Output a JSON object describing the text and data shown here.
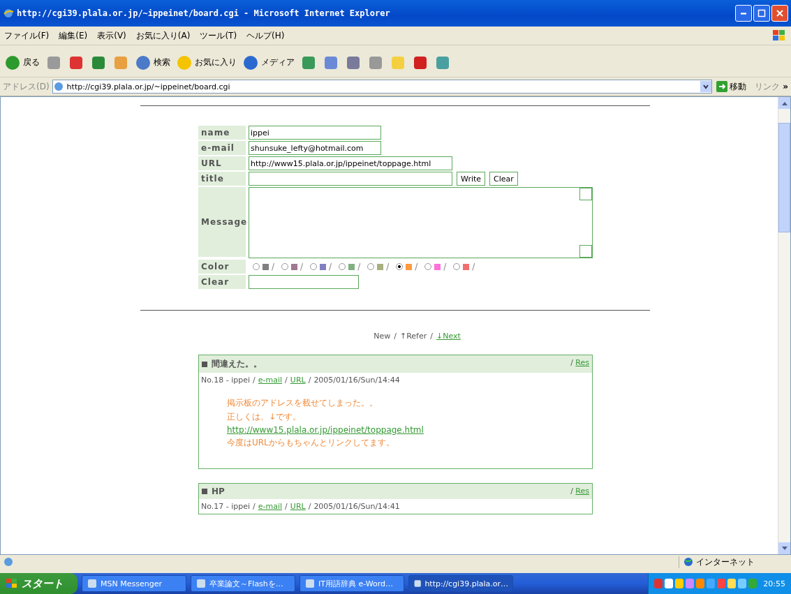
{
  "window": {
    "title": "http://cgi39.plala.or.jp/~ippeinet/board.cgi - Microsoft Internet Explorer"
  },
  "menu": [
    "ファイル(F)",
    "編集(E)",
    "表示(V)",
    "お気に入り(A)",
    "ツール(T)",
    "ヘルプ(H)"
  ],
  "toolbar": [
    {
      "kind": "back",
      "label": "戻る"
    },
    {
      "kind": "forward"
    },
    {
      "kind": "stop"
    },
    {
      "kind": "refresh"
    },
    {
      "kind": "home"
    },
    {
      "kind": "search",
      "label": "検索"
    },
    {
      "kind": "favorites",
      "label": "お気に入り"
    },
    {
      "kind": "media",
      "label": "メディア"
    },
    {
      "kind": "history"
    },
    {
      "kind": "mail"
    },
    {
      "kind": "print"
    },
    {
      "kind": "edit"
    },
    {
      "kind": "note"
    },
    {
      "kind": "messenger"
    },
    {
      "kind": "people"
    }
  ],
  "address": {
    "label": "アドレス(D)",
    "value": "http://cgi39.plala.or.jp/~ippeinet/board.cgi",
    "go": "移動",
    "links": "リンク",
    "more": "»"
  },
  "form": {
    "fields": [
      {
        "label": "name",
        "value": "ippei"
      },
      {
        "label": "e-mail",
        "value": "shunsuke_lefty@hotmail.com"
      },
      {
        "label": "URL",
        "value": "http://www15.plala.or.jp/ippeinet/toppage.html"
      },
      {
        "label": "title"
      }
    ],
    "buttons": [
      "Write",
      "Clear"
    ],
    "message_label": "Message",
    "color_label": "Color",
    "colors": [
      {
        "color": "#808080",
        "selected": false
      },
      {
        "color": "#a07890",
        "selected": false
      },
      {
        "color": "#8080c0",
        "selected": false
      },
      {
        "color": "#80b080",
        "selected": false
      },
      {
        "color": "#a8b080",
        "selected": false
      },
      {
        "color": "#ff9a40",
        "selected": true
      },
      {
        "color": "#ff70d8",
        "selected": false
      },
      {
        "color": "#f07070",
        "selected": false
      }
    ],
    "separator": "/",
    "clear_label": "Clear"
  },
  "nav": {
    "new": "New",
    "sep": "/",
    "refer": "↑Refer",
    "next": "↓Next"
  },
  "posts": [
    {
      "title": "間違えた。。",
      "sep": "/",
      "res": "Res",
      "no": "No.18 - ippei",
      "email": "e-mail",
      "url": "URL",
      "date": "2005/01/16/Sun/14:44",
      "body": [
        {
          "kind": "text",
          "text": "掲示板のアドレスを載せてしまった。。"
        },
        {
          "kind": "text",
          "text": "正しくは、↓です。"
        },
        {
          "kind": "link",
          "text": "http://www15.plala.or.jp/ippeinet/toppage.html"
        },
        {
          "kind": "text",
          "text": "今度はURLからもちゃんとリンクしてます。"
        }
      ]
    },
    {
      "title": "HP",
      "sep": "/",
      "res": "Res",
      "no": "No.17 - ippei",
      "email": "e-mail",
      "url": "URL",
      "date": "2005/01/16/Sun/14:41"
    }
  ],
  "status_bar": {
    "zone": "インターネット"
  },
  "taskbar": {
    "start": "スタート",
    "tasks": [
      {
        "label": "MSN Messenger",
        "selected": false
      },
      {
        "label": "卒業論文～Flashを…",
        "selected": false
      },
      {
        "label": "IT用語辞典 e-Word…",
        "selected": false
      },
      {
        "label": "http://cgi39.plala.or…",
        "selected": true
      }
    ],
    "clock": "20:55"
  }
}
